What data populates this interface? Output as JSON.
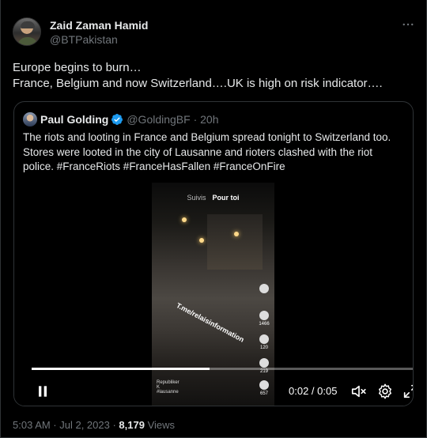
{
  "author": {
    "name": "Zaid Zaman Hamid",
    "handle": "@BTPakistan",
    "avatar_icon": "avatar-photo"
  },
  "more_icon": "ellipsis-icon",
  "tweet": {
    "line1": "Europe begins to burn…",
    "line2": "France, Belgium and now Switzerland….UK is high on risk indicator…."
  },
  "quote": {
    "name": "Paul Golding",
    "verified_icon": "verified-badge-icon",
    "handle_time": "@GoldingBF · 20h",
    "text": "The riots and looting in France and Belgium spread tonight to Switzerland too. Stores were looted in the city of Lausanne and rioters clashed with the riot police. #FranceRiots #FranceHasFallen #FranceOnFire"
  },
  "video": {
    "tab_suivis": "Suivis",
    "tab_pour_toi": "Pour toi",
    "watermark": "T.me/relaisinformation",
    "side_counts": [
      "1466",
      "120",
      "219",
      "657"
    ],
    "user_label": "Republiker",
    "user_tag": "K",
    "user_hashtag": "#lausanne",
    "progress_fraction": 0.46,
    "time": "0:02 / 0:05",
    "accent": "#ffffff"
  },
  "controls": {
    "pause_icon": "pause-icon",
    "volume_icon": "volume-mute-icon",
    "settings_icon": "gear-icon",
    "fullscreen_icon": "fullscreen-icon"
  },
  "meta": {
    "timestamp": "5:03 AM · Jul 2, 2023 · ",
    "views_count": "8,179",
    "views_label": " Views"
  },
  "colors": {
    "background": "#000000",
    "text": "#e7e9ea",
    "muted": "#71767b",
    "border": "#2f3336",
    "verified": "#1d9bf0"
  }
}
